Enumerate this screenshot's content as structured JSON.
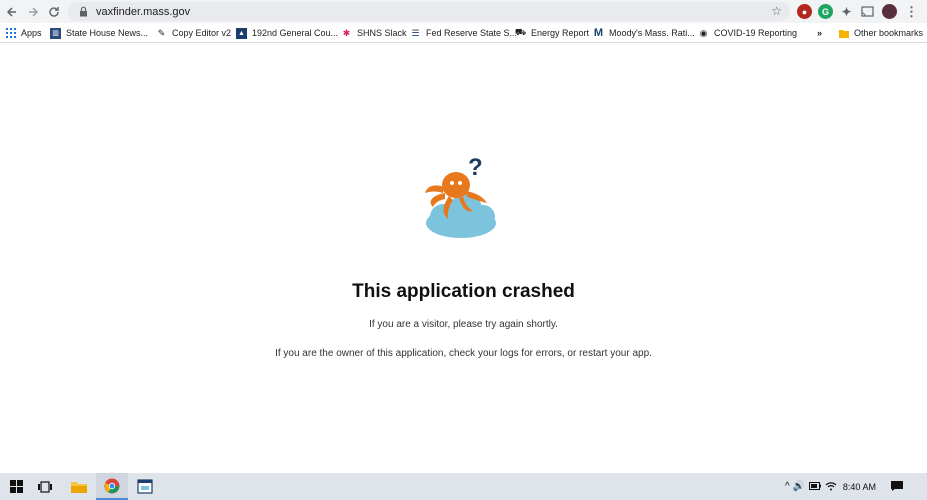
{
  "browser": {
    "url": "vaxfinder.mass.gov",
    "extension_colors": {
      "red": "#b2281f",
      "green": "#1fa463",
      "avatar": "#5a2e3a"
    }
  },
  "bookmarks": {
    "apps_label": "Apps",
    "items": [
      {
        "label": "State House News...",
        "icon": "building-icon"
      },
      {
        "label": "Copy Editor v2",
        "icon": "pen-icon"
      },
      {
        "label": "192nd General Cou...",
        "icon": "flag-icon"
      },
      {
        "label": "SHNS Slack",
        "icon": "slack-icon"
      },
      {
        "label": "Fed Reserve State S...",
        "icon": "list-icon"
      },
      {
        "label": "Energy Report",
        "icon": "car-icon"
      },
      {
        "label": "Moody's Mass. Rati...",
        "icon": "m-icon"
      },
      {
        "label": "COVID-19 Reporting",
        "icon": "seal-icon"
      }
    ],
    "overflow": "»",
    "other_label": "Other bookmarks"
  },
  "page": {
    "headline": "This application crashed",
    "line1": "If you are a visitor, please try again shortly.",
    "line2": "If you are the owner of this application, check your logs for errors, or restart your app.",
    "octopus_color": "#e8781e",
    "cloud_color": "#7cc4dd",
    "question_color": "#1e3a5f"
  },
  "taskbar": {
    "time": "8:40 AM",
    "tray_symbols": "^ 🔊"
  }
}
